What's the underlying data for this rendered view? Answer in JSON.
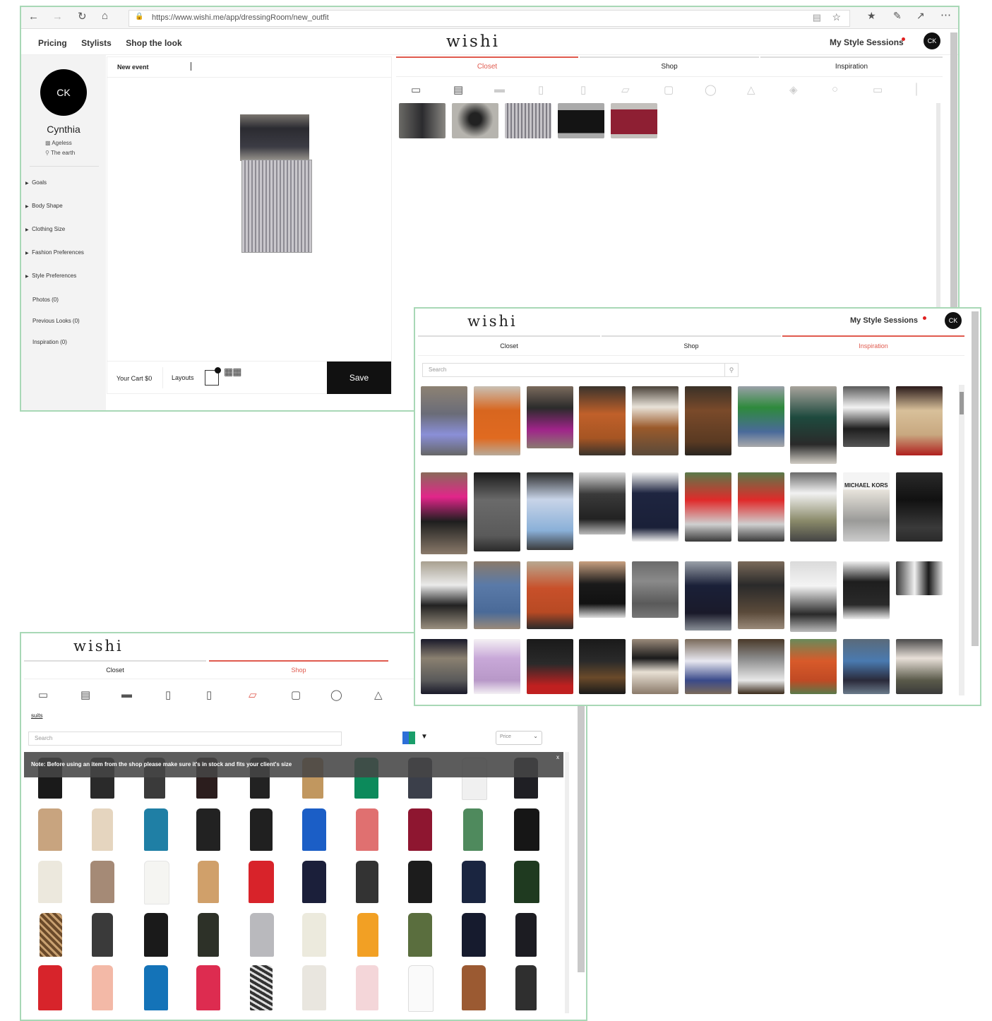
{
  "browser": {
    "url": "https://www.wishi.me/app/dressingRoom/new_outfit"
  },
  "brand": "wishi",
  "header": {
    "nav": [
      "Pricing",
      "Stylists",
      "Shop the look"
    ],
    "sessions": "My Style Sessions",
    "avatar": "CK"
  },
  "client": {
    "initials": "CK",
    "name": "Cynthia",
    "age": "Ageless",
    "location": "The earth",
    "sections": [
      "Goals",
      "Body Shape",
      "Clothing Size",
      "Fashion Preferences",
      "Style Preferences"
    ],
    "links": [
      "Photos (0)",
      "Previous Looks (0)",
      "Inspiration (0)"
    ]
  },
  "board": {
    "event_label": "New event",
    "cart": "Your Cart $0",
    "layouts": "Layouts",
    "save": "Save"
  },
  "tabs": {
    "closet": "Closet",
    "shop": "Shop",
    "inspiration": "Inspiration"
  },
  "inspiration_window": {
    "search_placeholder": "Search",
    "banner_text": "MICHAEL KORS"
  },
  "shop_window": {
    "breadcrumb": "suits",
    "search_placeholder": "Search",
    "price_label": "Price",
    "note": "Note: Before using an item from the shop please make sure it's in stock and fits your client's size",
    "note_close": "x"
  },
  "colors": {
    "accent": "#e05a4e",
    "frame": "#a8d8b6",
    "save_bg": "#111111"
  }
}
